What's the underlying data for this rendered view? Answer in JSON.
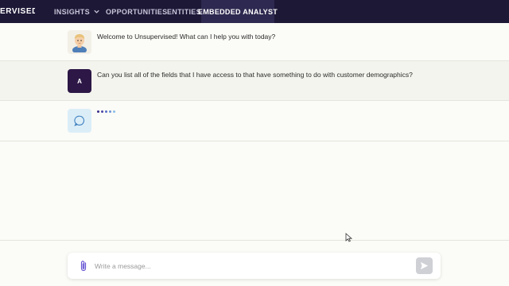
{
  "nav": {
    "brand": "ERVISED",
    "items": [
      {
        "label": "INSIGHTS",
        "has_dropdown": true
      },
      {
        "label": "OPPORTUNITIES"
      },
      {
        "label": "ENTITIES"
      },
      {
        "label": "EMBEDDED ANALYST",
        "active": true
      }
    ]
  },
  "chat": {
    "messages": [
      {
        "sender": "assistant",
        "text": "Welcome to Unsupervised! What can I help you with today?"
      },
      {
        "sender": "user",
        "avatar_initial": "A",
        "text": "Can you list all of the fields that I have access to that have something to do with customer demographics?"
      },
      {
        "sender": "assistant",
        "typing": true
      }
    ]
  },
  "composer": {
    "placeholder": "Write a message..."
  },
  "colors": {
    "nav_bg": "#1c1836",
    "nav_active_bg": "#2e2950",
    "user_avatar_bg": "#2c1746",
    "accent": "#6b5bd6"
  },
  "icons": {
    "attach": "paperclip-icon",
    "send": "send-icon",
    "assistant": "chat-bubble-icon",
    "dropdown": "chevron-down-icon"
  }
}
